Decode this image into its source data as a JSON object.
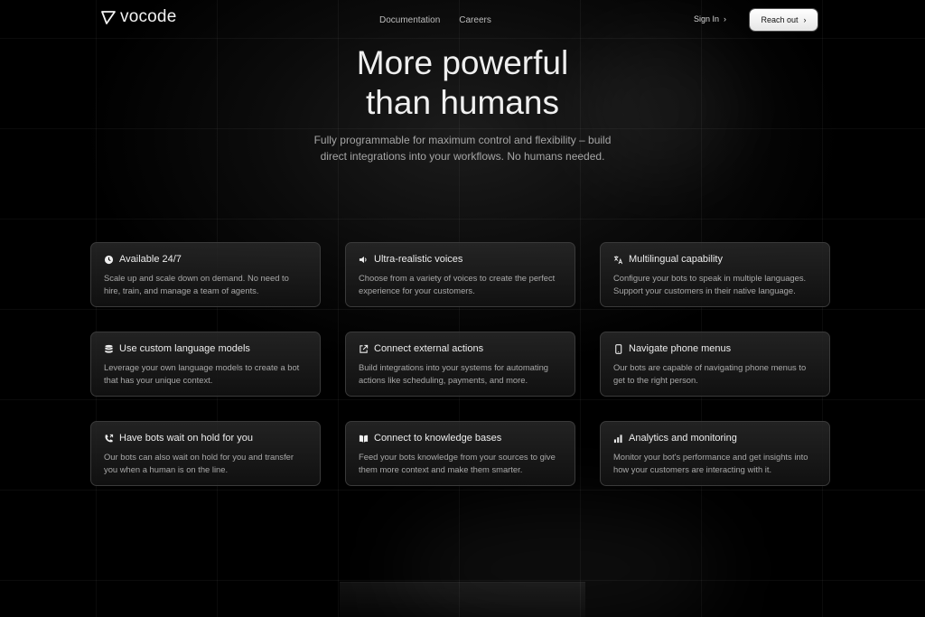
{
  "header": {
    "logo_text": "vocode",
    "nav": [
      "Documentation",
      "Careers"
    ],
    "signin_label": "Sign In",
    "reach_label": "Reach out"
  },
  "hero": {
    "title_line1": "More powerful",
    "title_line2": "than humans",
    "subtitle": "Fully programmable for maximum control and flexibility – build direct integrations into your workflows. No humans needed."
  },
  "features": [
    {
      "icon": "clock-icon",
      "title": "Available 24/7",
      "desc": "Scale up and scale down on demand. No need to hire, train, and manage a team of agents."
    },
    {
      "icon": "speaker-icon",
      "title": "Ultra-realistic voices",
      "desc": "Choose from a variety of voices to create the perfect experience for your customers."
    },
    {
      "icon": "translate-icon",
      "title": "Multilingual capability",
      "desc": "Configure your bots to speak in multiple languages. Support your customers in their native language."
    },
    {
      "icon": "database-icon",
      "title": "Use custom language models",
      "desc": "Leverage your own language models to create a bot that has your unique context."
    },
    {
      "icon": "external-link-icon",
      "title": "Connect external actions",
      "desc": "Build integrations into your systems for automating actions like scheduling, payments, and more."
    },
    {
      "icon": "phone-icon",
      "title": "Navigate phone menus",
      "desc": "Our bots are capable of navigating phone menus to get to the right person."
    },
    {
      "icon": "phone-forward-icon",
      "title": "Have bots wait on hold for you",
      "desc": "Our bots can also wait on hold for you and transfer you when a human is on the line."
    },
    {
      "icon": "book-icon",
      "title": "Connect to knowledge bases",
      "desc": "Feed your bots knowledge from your sources to give them more context and make them smarter."
    },
    {
      "icon": "bar-chart-icon",
      "title": "Analytics and monitoring",
      "desc": "Monitor your bot's performance and get insights into how your customers are interacting with it."
    }
  ],
  "colors": {
    "background": "#000000",
    "card_border": "#3a3a3a",
    "button_bg": "#ffffff"
  }
}
